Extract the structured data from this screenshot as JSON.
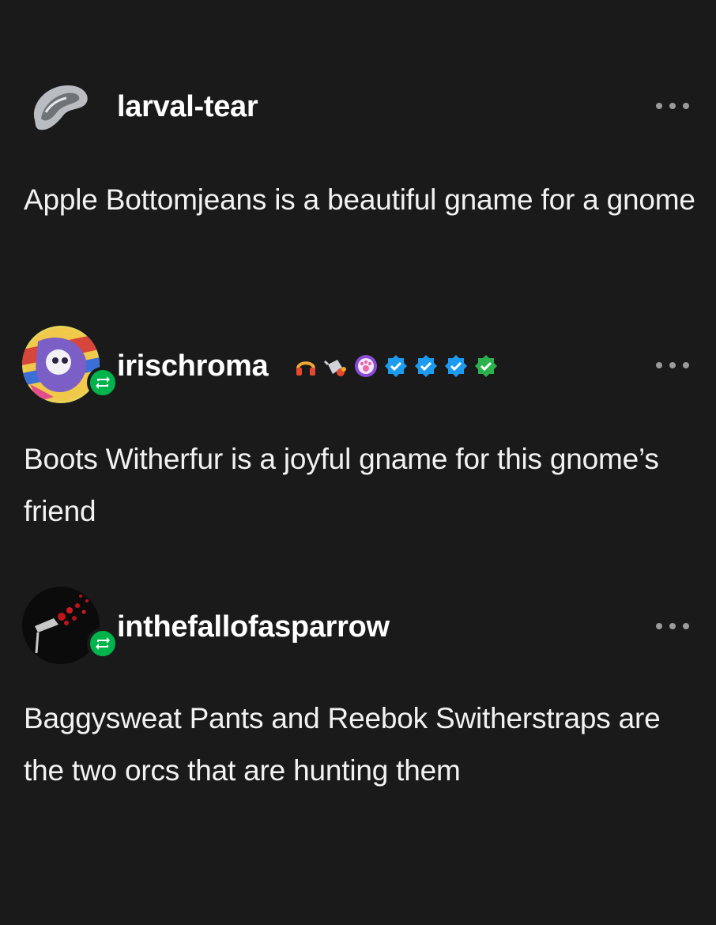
{
  "posts": [
    {
      "username": "larval-tear",
      "reblogged": false,
      "body": "Apple Bottomjeans is a beautiful gname for a gnome"
    },
    {
      "username": "irischroma",
      "reblogged": true,
      "badges": [
        "headphones-icon",
        "watering-can-icon",
        "paw-badge-icon",
        "verified-blue-icon",
        "verified-blue-icon",
        "verified-blue-icon",
        "verified-green-icon"
      ],
      "body": "Boots Witherfur is a joyful gname for this gnome’s friend"
    },
    {
      "username": "inthefallofasparrow",
      "reblogged": true,
      "body": "Baggysweat Pants and Reebok Switherstraps are the two orcs that are hunting them"
    }
  ],
  "colors": {
    "background": "#1a1a1b",
    "text": "#ffffff",
    "reblog_green": "#00b34a",
    "verified_blue": "#1d9bf0",
    "verified_green": "#2bb24c",
    "more_dots": "#9a9a9a"
  }
}
